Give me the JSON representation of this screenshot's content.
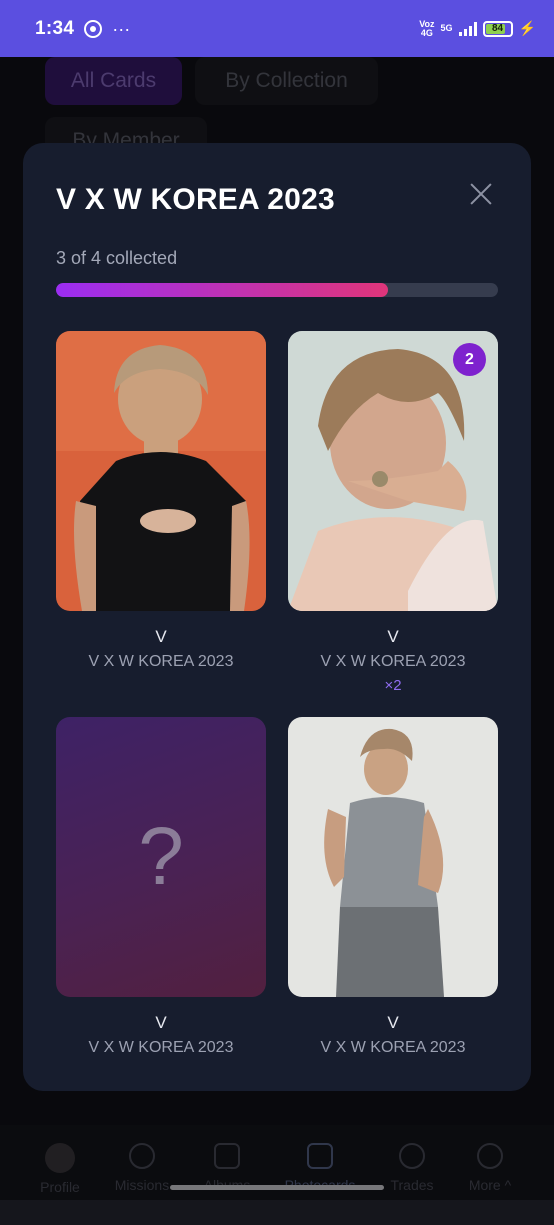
{
  "status_bar": {
    "time": "1:34",
    "network_top": "Voz",
    "network_bottom": "4G",
    "network2": "5G",
    "battery": "84"
  },
  "background": {
    "filters": [
      "All Cards",
      "By Collection",
      "By Member"
    ],
    "nav": [
      {
        "label": "Profile"
      },
      {
        "label": "Missions"
      },
      {
        "label": "Albums"
      },
      {
        "label": "Photocards"
      },
      {
        "label": "Trades"
      },
      {
        "label": "More ^"
      }
    ]
  },
  "modal": {
    "title": "V X W KOREA 2023",
    "progress_text": "3 of 4 collected",
    "progress_value": 0.75,
    "cards": [
      {
        "name": "V",
        "collection": "V X W KOREA 2023",
        "owned": true
      },
      {
        "name": "V",
        "collection": "V X W KOREA 2023",
        "owned": true,
        "badge": "2",
        "duplicates": "×2"
      },
      {
        "name": "V",
        "collection": "V X W KOREA 2023",
        "owned": false,
        "placeholder": "?"
      },
      {
        "name": "V",
        "collection": "V X W KOREA 2023",
        "owned": true
      }
    ]
  },
  "colors": {
    "status_bar": "#5b4fe0",
    "modal_bg": "#171d2e",
    "progress_start": "#9b2df2",
    "progress_end": "#e0357a",
    "badge": "#7e22ce"
  }
}
